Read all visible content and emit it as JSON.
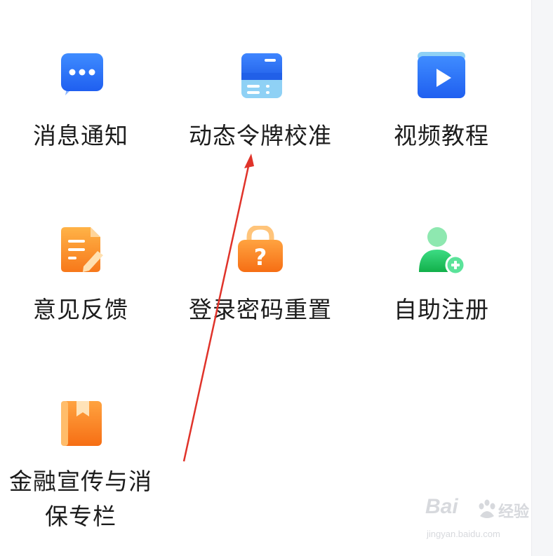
{
  "grid": {
    "items": [
      {
        "label": "消息通知",
        "icon": "message-bubble-icon",
        "color": "#2b6cf6"
      },
      {
        "label": "动态令牌校准",
        "icon": "token-card-icon",
        "color": "#2b6cf6"
      },
      {
        "label": "视频教程",
        "icon": "video-play-icon",
        "color": "#2b6cf6"
      },
      {
        "label": "意见反馈",
        "icon": "feedback-edit-icon",
        "color": "#f78a1d"
      },
      {
        "label": "登录密码重置",
        "icon": "lock-question-icon",
        "color": "#f78a1d"
      },
      {
        "label": "自助注册",
        "icon": "user-add-icon",
        "color": "#1fbf5c"
      },
      {
        "label": "金融宣传与消保专栏",
        "icon": "bookmark-book-icon",
        "color": "#f78a1d"
      }
    ]
  },
  "annotation": {
    "arrow_color": "#e0332a"
  },
  "watermark": {
    "brand": "Bai",
    "brand_suffix": "经验",
    "url": "jingyan.baidu.com"
  }
}
